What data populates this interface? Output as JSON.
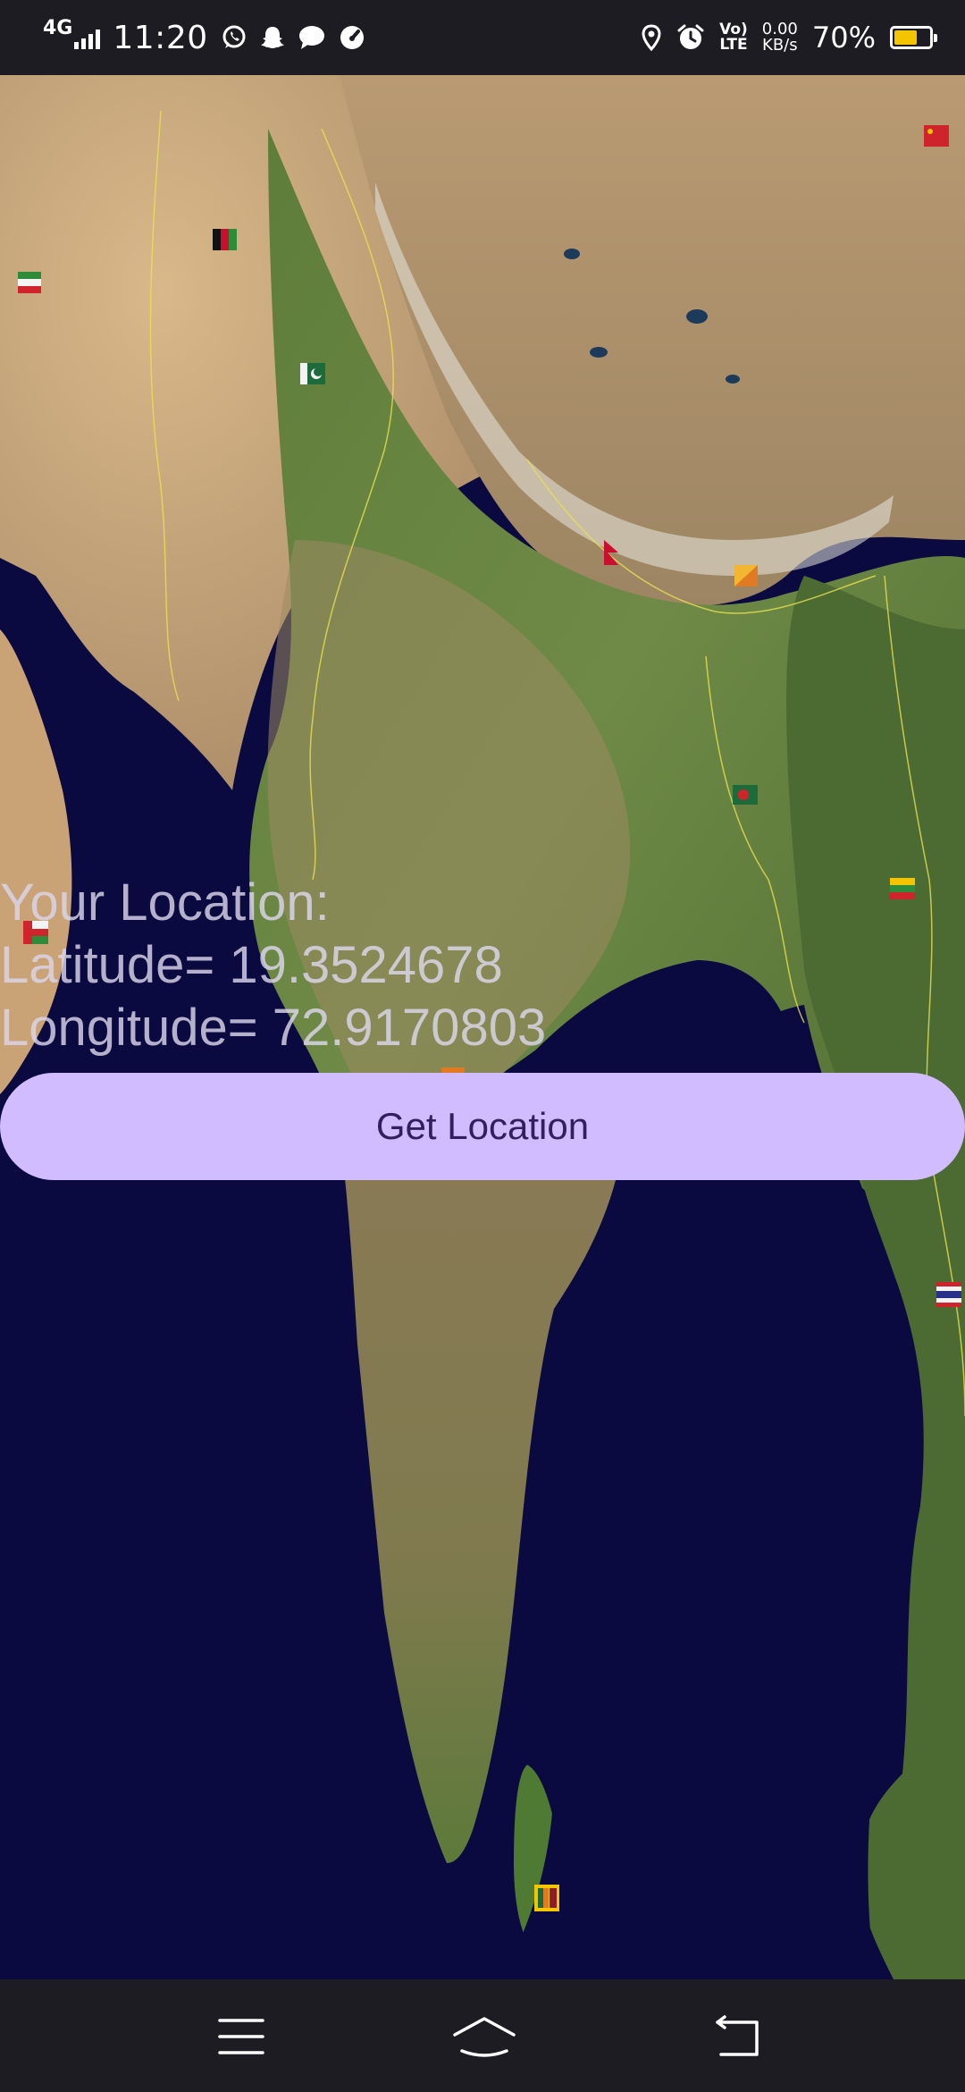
{
  "status_bar": {
    "network_type": "4G",
    "time": "11:20",
    "net_speed_value": "0.00",
    "net_speed_unit": "KB/s",
    "volte_label": "Vo) LTE",
    "battery_percent": "70%",
    "battery_level": 0.7,
    "battery_color": "#f5c400",
    "left_icons": [
      "whatsapp-icon",
      "snapchat-icon",
      "messages-icon",
      "speedometer-icon"
    ],
    "right_icons": [
      "location-icon",
      "alarm-icon",
      "volte-icon"
    ]
  },
  "location": {
    "heading": "Your Location:",
    "latitude_line": "Latitude= 19.3524678",
    "longitude_line": "Longitude= 72.9170803"
  },
  "button": {
    "label": "Get Location",
    "background": "#d0bcff",
    "text_color": "#32205e"
  },
  "nav_bar": {
    "icons": [
      "menu-icon",
      "home-icon",
      "back-icon"
    ]
  }
}
